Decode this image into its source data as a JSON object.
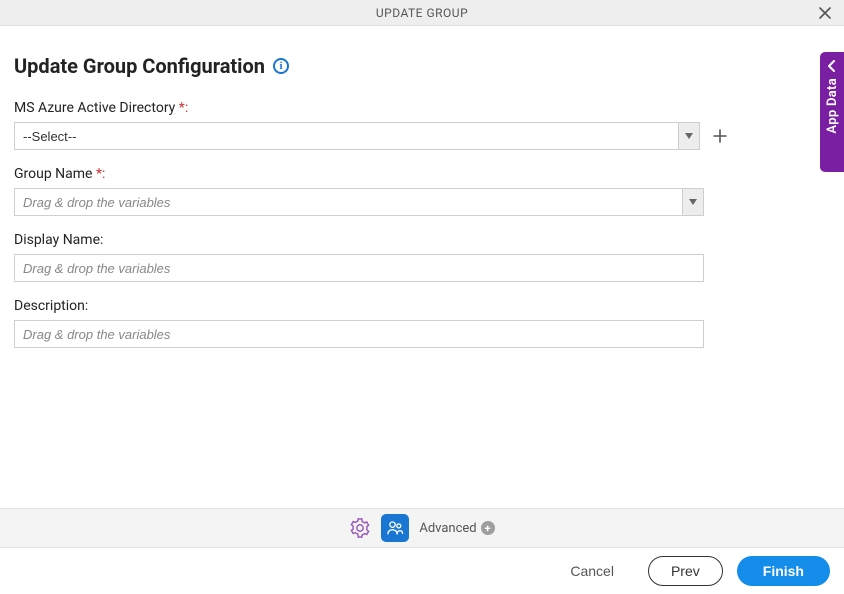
{
  "window": {
    "title": "UPDATE GROUP"
  },
  "page": {
    "heading": "Update Group Configuration"
  },
  "side_panel": {
    "label": "App Data"
  },
  "fields": {
    "azure_ad": {
      "label": "MS Azure Active Directory",
      "required_suffix": " *:",
      "value": "--Select--"
    },
    "group_name": {
      "label": "Group Name",
      "required_suffix": " *:",
      "placeholder": "Drag & drop the variables"
    },
    "display_name": {
      "label": "Display Name:",
      "placeholder": "Drag & drop the variables"
    },
    "description": {
      "label": "Description:",
      "placeholder": "Drag & drop the variables"
    }
  },
  "toolbar": {
    "advanced_label": "Advanced"
  },
  "footer": {
    "cancel": "Cancel",
    "prev": "Prev",
    "finish": "Finish"
  }
}
